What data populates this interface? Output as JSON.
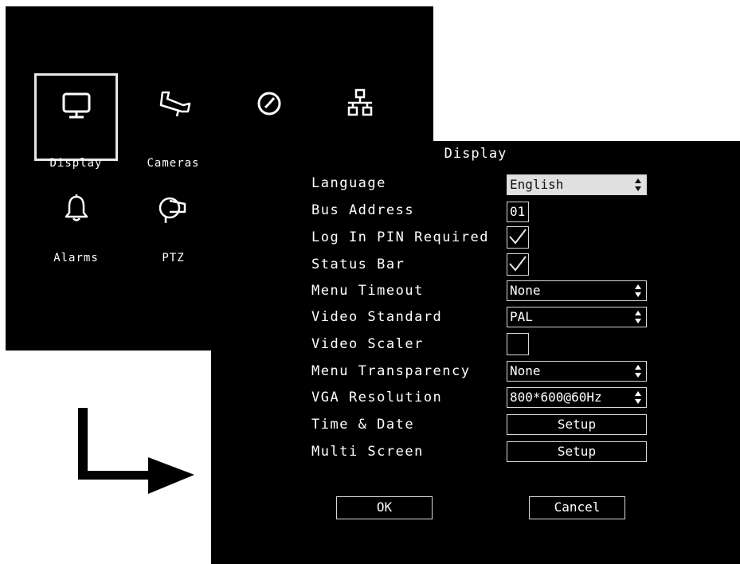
{
  "main_menu": {
    "items": [
      {
        "label": "Display",
        "icon": "monitor-icon"
      },
      {
        "label": "Cameras",
        "icon": "camera-icon"
      },
      {
        "label": "",
        "icon": "clock-icon"
      },
      {
        "label": "",
        "icon": "network-icon"
      },
      {
        "label": "Alarms",
        "icon": "bell-icon"
      },
      {
        "label": "PTZ",
        "icon": "ptz-camera-icon"
      }
    ]
  },
  "dialog": {
    "title": "Display",
    "rows": {
      "language": {
        "label": "Language",
        "value": "English"
      },
      "bus_address": {
        "label": "Bus Address",
        "value": "01"
      },
      "login_pin": {
        "label": "Log In PIN Required",
        "checked": true
      },
      "status_bar": {
        "label": "Status Bar",
        "checked": true
      },
      "menu_timeout": {
        "label": "Menu Timeout",
        "value": "None"
      },
      "video_standard": {
        "label": "Video Standard",
        "value": "PAL"
      },
      "video_scaler": {
        "label": "Video Scaler",
        "checked": false
      },
      "menu_transparency": {
        "label": "Menu Transparency",
        "value": "None"
      },
      "vga_resolution": {
        "label": "VGA Resolution",
        "value": "800*600@60Hz"
      },
      "time_date": {
        "label": "Time & Date",
        "button": "Setup"
      },
      "multi_screen": {
        "label": "Multi Screen",
        "button": "Setup"
      }
    },
    "ok_label": "OK",
    "cancel_label": "Cancel"
  },
  "colors": {
    "background": "#000000",
    "text": "#ffffff",
    "border": "#d8d8d8",
    "focused_field": "#e0e0e0"
  }
}
